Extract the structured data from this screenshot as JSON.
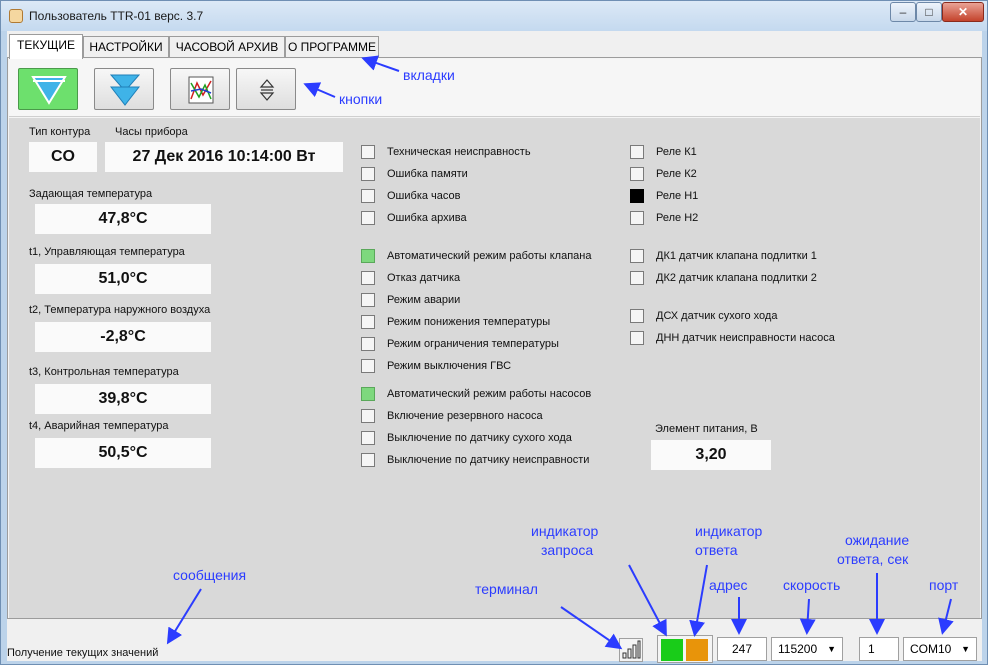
{
  "window": {
    "title": "Пользователь TTR-01 верс. 3.7"
  },
  "tabs": [
    {
      "label": "ТЕКУЩИЕ"
    },
    {
      "label": "НАСТРОЙКИ"
    },
    {
      "label": "ЧАСОВОЙ АРХИВ"
    },
    {
      "label": "О ПРОГРАММЕ"
    }
  ],
  "toolbar": {
    "button_icons": [
      "funnel-down-icon",
      "double-funnel-icon",
      "chart-icon",
      "up-down-arrows-icon"
    ]
  },
  "readings": {
    "circuit_type_label": "Тип контура",
    "circuit_type_value": "CO",
    "clock_label": "Часы прибора",
    "clock_value": "27 Дек 2016 10:14:00 Вт",
    "set_temp_label": "Задающая температура",
    "set_temp_value": "47,8°C",
    "t1_label": "t1, Управляющая температура",
    "t1_value": "51,0°C",
    "t2_label": "t2, Температура наружного воздуха",
    "t2_value": "-2,8°C",
    "t3_label": "t3, Контрольная температура",
    "t3_value": "39,8°C",
    "t4_label": "t4, Аварийная температура",
    "t4_value": "50,5°C",
    "battery_label": "Элемент питания, В",
    "battery_value": "3,20"
  },
  "flags_col1": [
    {
      "label": "Техническая неисправность",
      "state": "off"
    },
    {
      "label": "Ошибка памяти",
      "state": "off"
    },
    {
      "label": "Ошибка часов",
      "state": "off"
    },
    {
      "label": "Ошибка архива",
      "state": "off"
    },
    {
      "label": "Автоматический режим работы клапана",
      "state": "green"
    },
    {
      "label": "Отказ датчика",
      "state": "off"
    },
    {
      "label": "Режим аварии",
      "state": "off"
    },
    {
      "label": "Режим понижения температуры",
      "state": "off"
    },
    {
      "label": "Режим ограничения температуры",
      "state": "off"
    },
    {
      "label": "Режим выключения ГВС",
      "state": "off"
    },
    {
      "label": "Автоматический режим работы насосов",
      "state": "green"
    },
    {
      "label": "Включение резервного насоса",
      "state": "off"
    },
    {
      "label": "Выключение по датчику сухого хода",
      "state": "off"
    },
    {
      "label": "Выключение по датчику неисправности",
      "state": "off"
    }
  ],
  "flags_col2": [
    {
      "label": "Реле К1",
      "state": "off"
    },
    {
      "label": "Реле К2",
      "state": "off"
    },
    {
      "label": "Реле Н1",
      "state": "black"
    },
    {
      "label": "Реле Н2",
      "state": "off"
    },
    {
      "label": "ДК1 датчик клапана подлитки 1",
      "state": "off"
    },
    {
      "label": "ДК2 датчик клапана подлитки 2",
      "state": "off"
    },
    {
      "label": "ДСХ датчик сухого хода",
      "state": "off"
    },
    {
      "label": "ДНН датчик неисправности насоса",
      "state": "off"
    }
  ],
  "status": {
    "message": "Получение текущих значений",
    "address": "247",
    "speed": "115200",
    "timeout": "1",
    "port": "COM10",
    "request_color": "#19cc19",
    "response_color": "#e8940a"
  },
  "annotations": {
    "tabs": "вкладки",
    "buttons": "кнопки",
    "messages": "сообщения",
    "terminal": "терминал",
    "request_indicator_1": "индикатор",
    "request_indicator_2": "запроса",
    "response_indicator_1": "индикатор",
    "response_indicator_2": "ответа",
    "address": "адрес",
    "speed": "скорость",
    "timeout_1": "ожидание",
    "timeout_2": "ответа, сек",
    "port": "порт"
  }
}
